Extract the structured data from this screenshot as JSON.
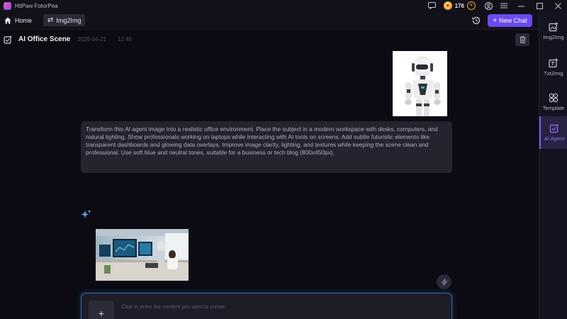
{
  "app": {
    "name": "HitPaw FotorPea"
  },
  "titlebar": {
    "coins": "176"
  },
  "nav": {
    "home_label": "Home",
    "active_tab_label": "Img2Img",
    "new_chat_label": "New Chat"
  },
  "sidebar": {
    "items": [
      {
        "label": "Img2Img",
        "icon": "image-add-icon"
      },
      {
        "label": "Txt2Img",
        "icon": "text-image-icon"
      },
      {
        "label": "Template",
        "icon": "template-grid-icon"
      },
      {
        "label": "AI Agent",
        "icon": "ai-agent-icon",
        "active": true
      }
    ]
  },
  "chat": {
    "title": "AI Office Scene",
    "date": "2026-04-21",
    "time": "12:45",
    "prompt": "Transform this AI agent image into a realistic office environment. Place the subject in a modern workspace with desks, computers, and natural lighting. Show professionals working on laptops while interacting with AI tools on screens. Add subtle futuristic elements like transparent dashboards and glowing data overlays. Improve image clarity, lighting, and textures while keeping the scene clean and professional. Use soft blue and neutral tones, suitable for a business or tech blog (800x450px)."
  },
  "input": {
    "placeholder": "Click to enter the content you want to create."
  },
  "colors": {
    "accent": "#6b4bf0",
    "background": "#0c0b14",
    "input_glow": "#2c6fa8"
  }
}
